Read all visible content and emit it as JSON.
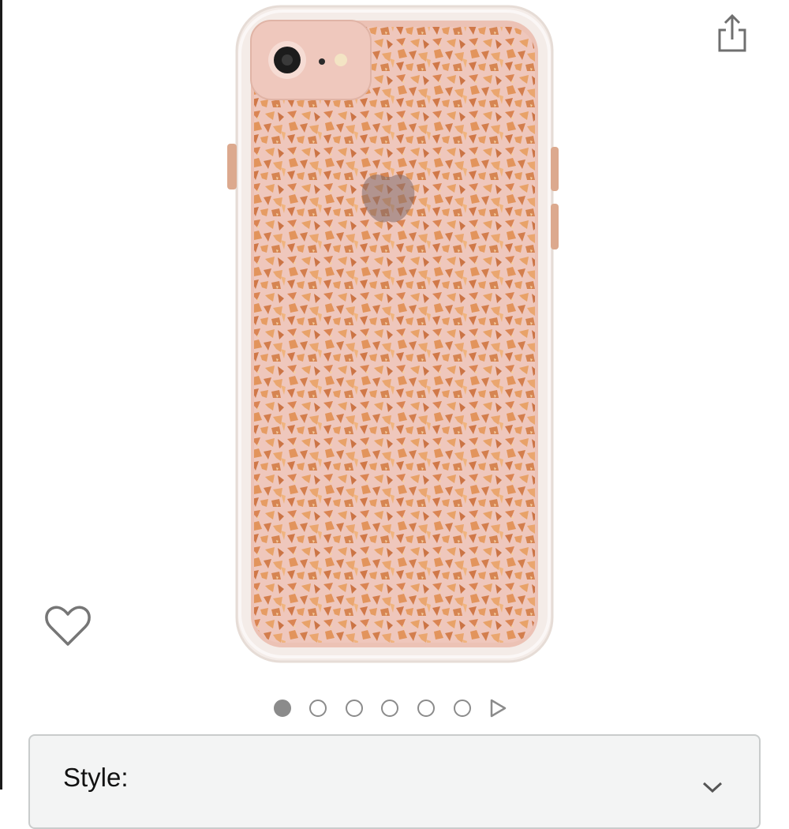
{
  "header": {
    "share_icon": "share-icon"
  },
  "product": {
    "image_description_icon": "phone-case-image",
    "case_color": "#e9b7a8",
    "flake_color": "#d9824e"
  },
  "wishlist": {
    "icon": "heart-outline-icon"
  },
  "carousel": {
    "total_dots": 6,
    "active_index": 0,
    "next_icon": "play-triangle-icon"
  },
  "style_selector": {
    "label": "Style:",
    "icon": "chevron-down-icon"
  }
}
